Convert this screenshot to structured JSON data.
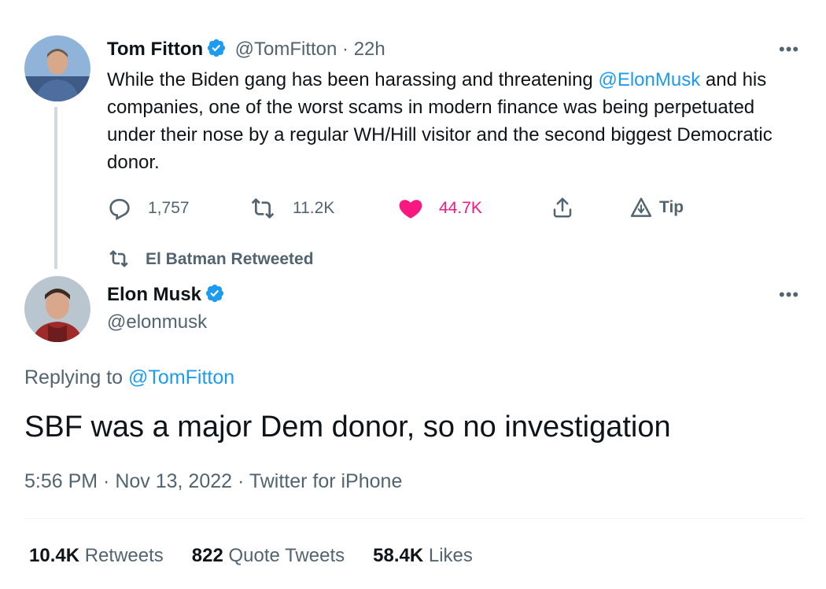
{
  "quoted": {
    "name": "Tom Fitton",
    "handle": "@TomFitton",
    "time_sep": " · ",
    "time": "22h",
    "more": "•••",
    "text_part1": "While the Biden gang has been harassing and threatening ",
    "mention": "@ElonMusk",
    "text_part2": " and his companies, one of the worst scams in modern finance was being perpetuated under their nose by a regular WH/Hill visitor and the second biggest Democratic donor.",
    "actions": {
      "replies": "1,757",
      "retweets": "11.2K",
      "likes": "44.7K",
      "tip": "Tip"
    }
  },
  "retweet_context": {
    "label": "El Batman Retweeted"
  },
  "main": {
    "name": "Elon Musk",
    "handle": "@elonmusk",
    "more": "•••",
    "replying_prefix": "Replying to ",
    "replying_to": "@TomFitton",
    "text": "SBF was a major Dem donor, so no investigation",
    "time": "5:56 PM",
    "date": "Nov 13, 2022",
    "source": "Twitter for iPhone",
    "meta_sep": " · "
  },
  "stats": {
    "retweets_count": "10.4K",
    "retweets_label": " Retweets",
    "quotes_count": "822",
    "quotes_label": " Quote Tweets",
    "likes_count": "58.4K",
    "likes_label": " Likes"
  },
  "colors": {
    "accent": "#1d9bf0",
    "like": "#f91880",
    "secondary_text": "#536471",
    "primary_text": "#0f1419"
  },
  "icons": {
    "verified": "verified-badge-icon",
    "reply": "reply-icon",
    "retweet": "retweet-icon",
    "like": "heart-icon",
    "share": "share-icon",
    "tip": "tip-icon",
    "more": "more-icon"
  }
}
